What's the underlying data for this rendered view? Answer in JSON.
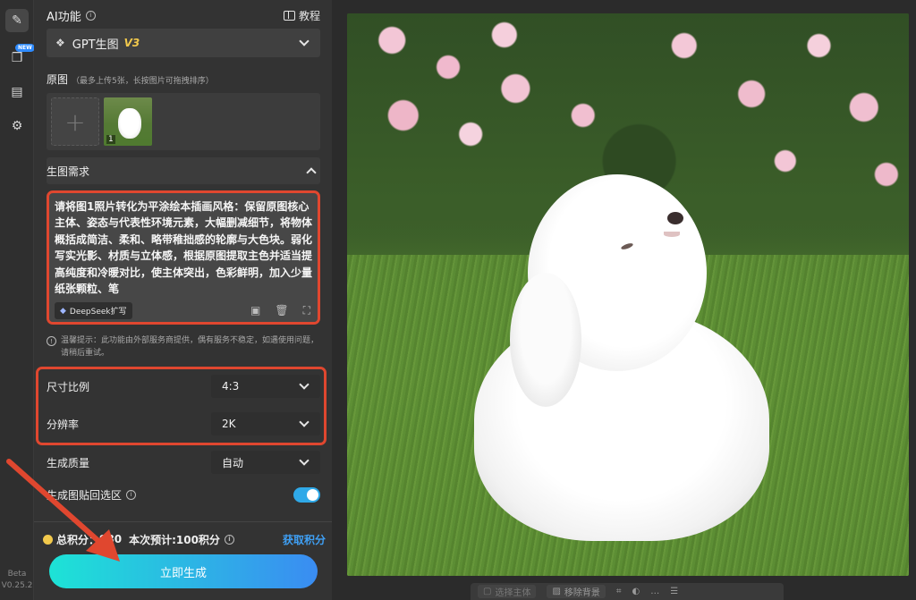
{
  "rail": {
    "version_line1": "Beta",
    "version_line2": "V0.25.2",
    "new_badge": "NEW"
  },
  "ai": {
    "title": "AI功能",
    "tutorial_label": "教程",
    "model_name": "GPT生图",
    "model_version": "V3"
  },
  "original": {
    "title": "原图",
    "hint": "（最多上传5张，长按图片可拖拽排序）",
    "thumb_index": "1"
  },
  "requirement": {
    "title": "生图需求",
    "prompt": "请将图1照片转化为平涂绘本插画风格：保留原图核心主体、姿态与代表性环境元素，大幅删减细节，将物体概括成简洁、柔和、略带稚拙感的轮廓与大色块。弱化写实光影、材质与立体感，根据原图提取主色并适当提高纯度和冷暖对比，使主体突出，色彩鲜明，加入少量纸张颗粒、笔",
    "deepseek_label": "DeepSeek扩写"
  },
  "notice": "温馨提示：此功能由外部服务商提供，偶有服务不稳定，如遇使用问题，请稍后重试。",
  "options": {
    "size_label": "尺寸比例",
    "size_value": "4:3",
    "resolution_label": "分辨率",
    "resolution_value": "2K",
    "quality_label": "生成质量",
    "quality_value": "自动",
    "paste_back_label": "生成图贴回选区",
    "paste_back_on": true
  },
  "points": {
    "total_label": "总积分：",
    "total_value": "980",
    "estimate_label": "本次预计:100积分",
    "get_points_label": "获取积分"
  },
  "generate_label": "立即生成",
  "toolbar": {
    "select_subject": "选择主体",
    "remove_bg": "移除背景"
  },
  "colors": {
    "accent_red": "#e0472f",
    "button_gradient_start": "#1de3d6",
    "button_gradient_end": "#3a8cf2",
    "link_blue": "#3fa0f5",
    "version_gold": "#f2c94c"
  }
}
